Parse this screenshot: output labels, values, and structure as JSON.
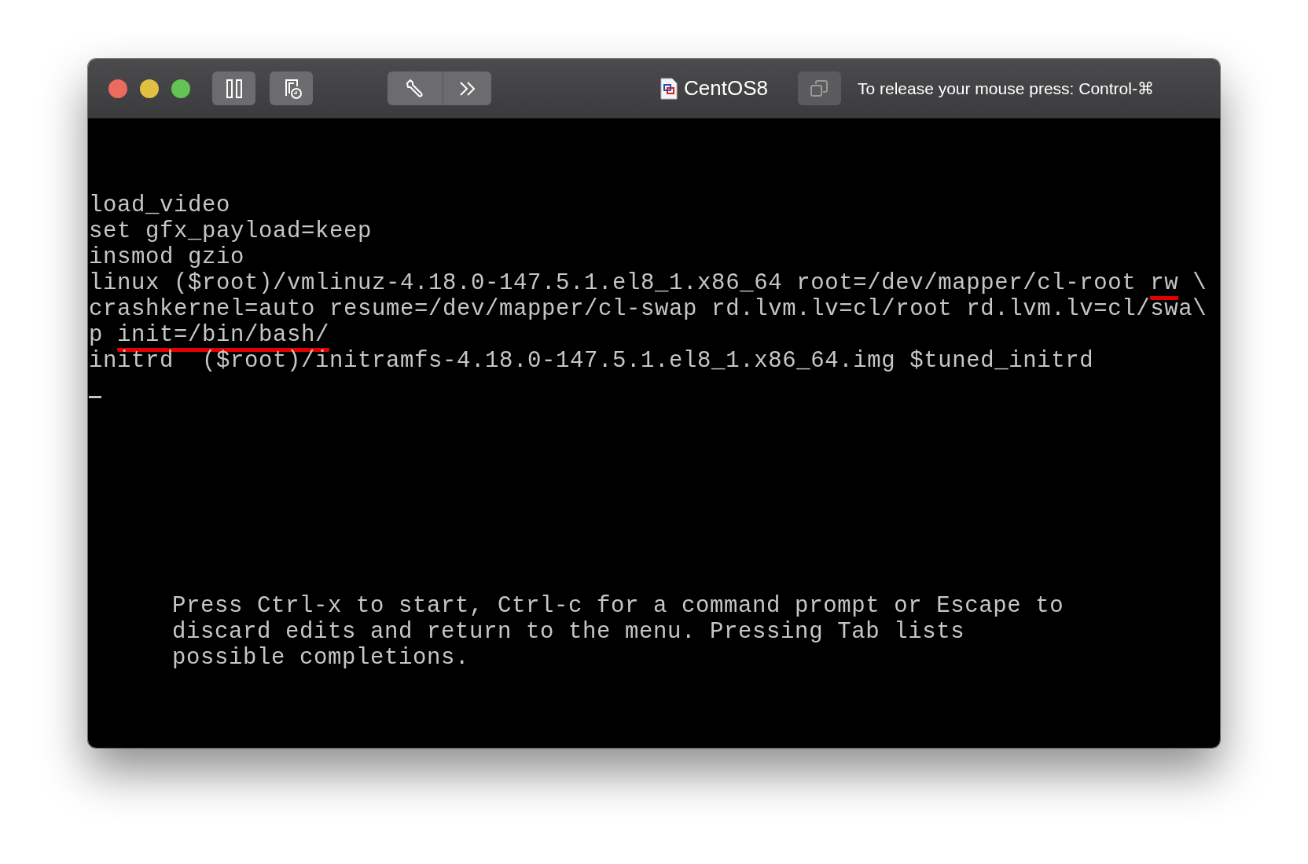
{
  "window": {
    "title": "CentOS8",
    "release_hint": "To release your mouse press: Control-⌘"
  },
  "editor": {
    "lines": [
      {
        "segments": [
          {
            "text": "load_video",
            "underlined": false
          }
        ]
      },
      {
        "segments": [
          {
            "text": "set gfx_payload=keep",
            "underlined": false
          }
        ]
      },
      {
        "segments": [
          {
            "text": "insmod gzio",
            "underlined": false
          }
        ]
      },
      {
        "segments": [
          {
            "text": "linux ($root)/vmlinuz-4.18.0-147.5.1.el8_1.x86_64 root=/dev/mapper/cl-root ",
            "underlined": false
          },
          {
            "text": "rw",
            "underlined": true
          },
          {
            "text": " \\",
            "underlined": false
          }
        ]
      },
      {
        "segments": [
          {
            "text": "crashkernel=auto resume=/dev/mapper/cl-swap rd.lvm.lv=cl/root rd.lvm.lv=cl/swa\\",
            "underlined": false
          }
        ]
      },
      {
        "segments": [
          {
            "text": "p ",
            "underlined": false
          },
          {
            "text": "init=/bin/bash/",
            "underlined": true
          }
        ]
      },
      {
        "segments": [
          {
            "text": "initrd  ($root)/initramfs-4.18.0-147.5.1.el8_1.x86_64.img $tuned_initrd",
            "underlined": false
          }
        ]
      }
    ],
    "help": [
      "Press Ctrl-x to start, Ctrl-c for a command prompt or Escape to",
      "discard edits and return to the menu. Pressing Tab lists",
      "possible completions."
    ]
  }
}
